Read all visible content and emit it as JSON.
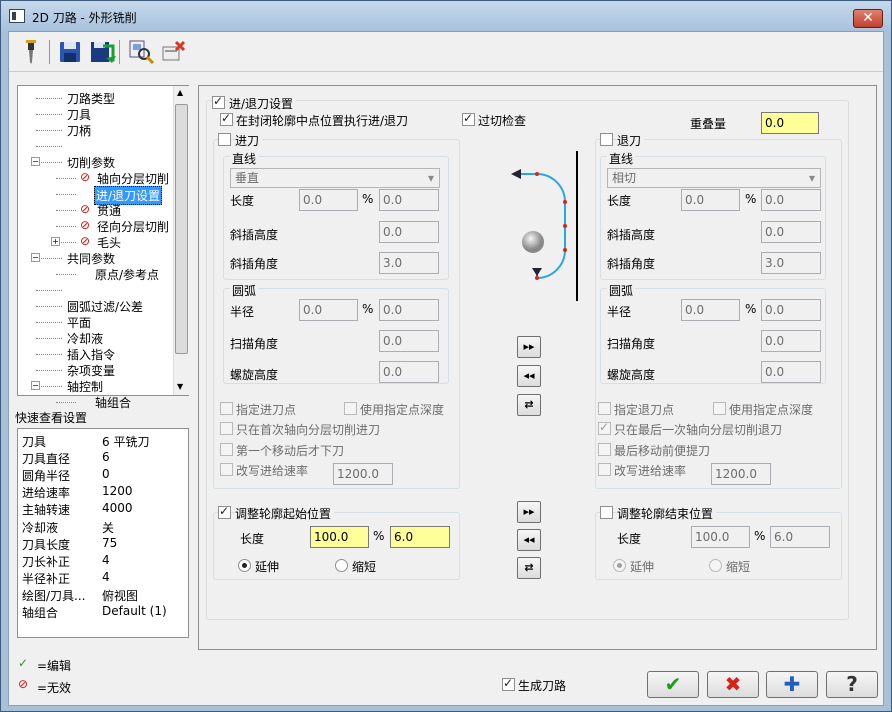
{
  "window": {
    "title": "2D 刀路 - 外形铣削",
    "close": "✕"
  },
  "toolbar": {
    "icons": [
      "tool-icon",
      "save-icon",
      "save-all-icon",
      "preview-icon",
      "delete-icon"
    ]
  },
  "tree": {
    "items": [
      {
        "label": "刀路类型",
        "level": 1
      },
      {
        "label": "刀具",
        "level": 1
      },
      {
        "label": "刀柄",
        "level": 1
      },
      {
        "label": "",
        "level": 1
      },
      {
        "label": "切削参数",
        "level": 1,
        "expander": "−"
      },
      {
        "label": "轴向分层切削",
        "level": 2,
        "invalid": true
      },
      {
        "label": "进/退刀设置",
        "level": 2,
        "selected": true
      },
      {
        "label": "贯通",
        "level": 2,
        "invalid": true
      },
      {
        "label": "径向分层切削",
        "level": 2,
        "invalid": true
      },
      {
        "label": "毛头",
        "level": 2,
        "invalid": true,
        "expander": "+"
      },
      {
        "label": "共同参数",
        "level": 1,
        "expander": "−"
      },
      {
        "label": "原点/参考点",
        "level": 2
      },
      {
        "label": "",
        "level": 1
      },
      {
        "label": "圆弧过滤/公差",
        "level": 1
      },
      {
        "label": "平面",
        "level": 1
      },
      {
        "label": "冷却液",
        "level": 1
      },
      {
        "label": "插入指令",
        "level": 1
      },
      {
        "label": "杂项变量",
        "level": 1
      },
      {
        "label": "轴控制",
        "level": 1,
        "expander": "−"
      },
      {
        "label": "轴组合",
        "level": 2
      }
    ]
  },
  "quick": {
    "title": "快速查看设置",
    "rows": [
      [
        "刀具",
        "6 平铣刀"
      ],
      [
        "刀具直径",
        "6"
      ],
      [
        "圆角半径",
        "0"
      ],
      [
        "进给速率",
        "1200"
      ],
      [
        "主轴转速",
        "4000"
      ],
      [
        "冷却液",
        "关"
      ],
      [
        "刀具长度",
        "75"
      ],
      [
        "刀长补正",
        "4"
      ],
      [
        "半径补正",
        "4"
      ],
      [
        "绘图/刀具...",
        "俯视图"
      ],
      [
        "轴组合",
        "Default (1)"
      ]
    ]
  },
  "legend": {
    "edit_icon": "✓",
    "edit": "=编辑",
    "invalid_icon": "⊘",
    "invalid": "=无效"
  },
  "main": {
    "entry_exit_label": "进/退刀设置",
    "midpoint_label": "在封闭轮廓中点位置执行进/退刀",
    "gouge_check": "过切检查",
    "overlap_label": "重叠量",
    "overlap_value": "0.0",
    "entry": {
      "title": "进刀",
      "line": "直线",
      "line_mode": "垂直",
      "length": "长度",
      "length_val": "0.0",
      "pct": "%",
      "length_pct": "0.0",
      "ramp_height": "斜插高度",
      "ramp_height_val": "0.0",
      "ramp_angle": "斜插角度",
      "ramp_angle_val": "3.0",
      "arc": "圆弧",
      "radius": "半径",
      "radius_val": "0.0",
      "radius_pct": "0.0",
      "sweep": "扫描角度",
      "sweep_val": "0.0",
      "helix": "螺旋高度",
      "helix_val": "0.0",
      "specify_point": "指定进刀点",
      "use_depth": "使用指定点深度",
      "first_only": "只在首次轴向分层切削进刀",
      "first_move": "第一个移动后才下刀",
      "override_feed": "改写进给速率",
      "feed_val": "1200.0"
    },
    "exit": {
      "title": "退刀",
      "line": "直线",
      "line_mode": "相切",
      "length": "长度",
      "length_val": "0.0",
      "pct": "%",
      "length_pct": "0.0",
      "ramp_height": "斜插高度",
      "ramp_height_val": "0.0",
      "ramp_angle": "斜插角度",
      "ramp_angle_val": "3.0",
      "arc": "圆弧",
      "radius": "半径",
      "radius_val": "0.0",
      "radius_pct": "0.0",
      "sweep": "扫描角度",
      "sweep_val": "0.0",
      "helix": "螺旋高度",
      "helix_val": "0.0",
      "specify_point": "指定退刀点",
      "use_depth": "使用指定点深度",
      "last_only": "只在最后一次轴向分层切削退刀",
      "last_move": "最后移动前便提刀",
      "override_feed": "改写进给速率",
      "feed_val": "1200.0"
    },
    "adjust_start": {
      "title": "调整轮廓起始位置",
      "length": "长度",
      "length_val": "100.0",
      "pct": "%",
      "pct_val": "6.0",
      "extend": "延伸",
      "shorten": "缩短"
    },
    "adjust_end": {
      "title": "调整轮廓结束位置",
      "length": "长度",
      "length_val": "100.0",
      "pct": "%",
      "pct_val": "6.0",
      "extend": "延伸",
      "shorten": "缩短"
    },
    "arrows": {
      "copy_right": "▸▸",
      "copy_left": "◂◂",
      "swap": "⇄"
    }
  },
  "bottom": {
    "generate_toolpath": "生成刀路",
    "ok": "✔",
    "cancel": "✖",
    "apply": "✚",
    "help": "?"
  },
  "colors": {
    "ok": "#1c9b1c",
    "cancel": "#d8231b",
    "apply": "#1f5fc1",
    "highlight_field": "#ffff99",
    "selected_item": "#3399ff"
  }
}
